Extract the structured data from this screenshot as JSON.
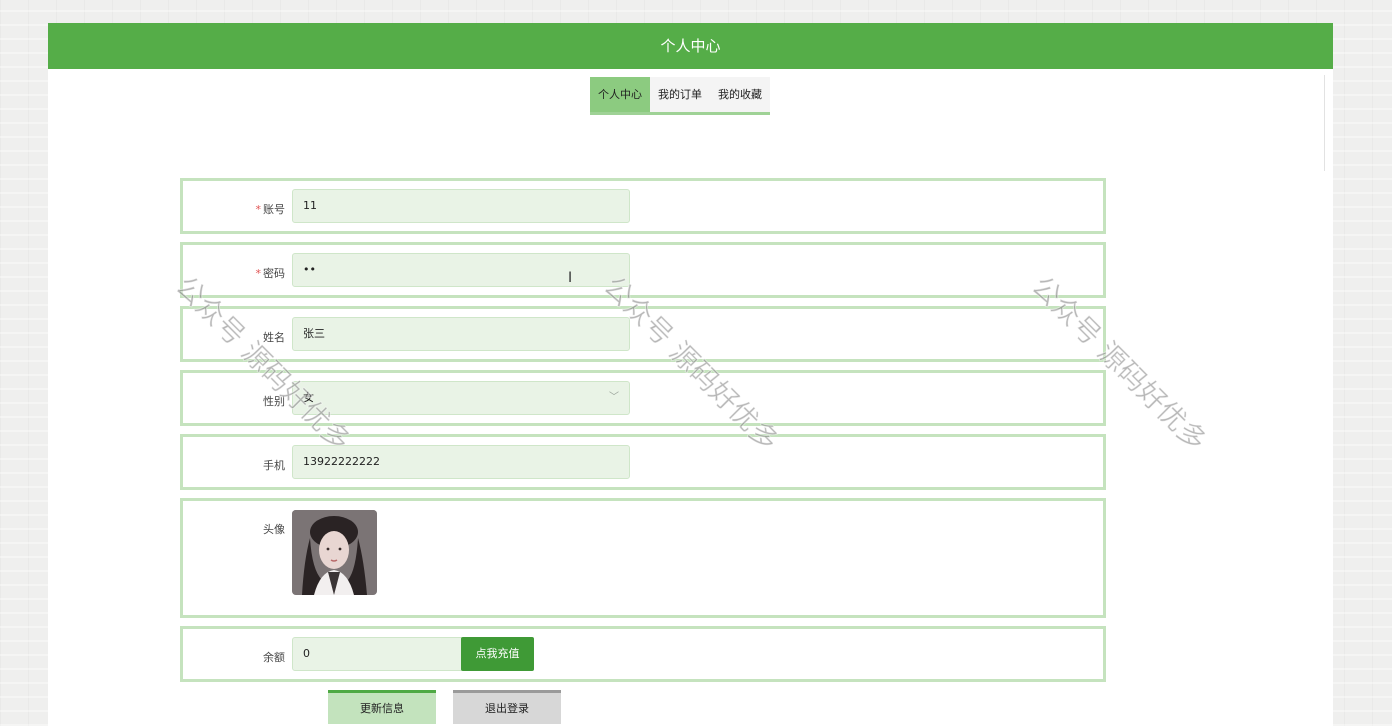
{
  "header": {
    "title": "个人中心"
  },
  "tabs": [
    {
      "label": "个人中心",
      "active": true
    },
    {
      "label": "我的订单",
      "active": false
    },
    {
      "label": "我的收藏",
      "active": false
    }
  ],
  "form": {
    "account": {
      "label": "账号",
      "value": "11",
      "required_mark": "*"
    },
    "password": {
      "label": "密码",
      "value": "••",
      "required_mark": "*"
    },
    "name": {
      "label": "姓名",
      "value": "张三"
    },
    "gender": {
      "label": "性别",
      "value": "女"
    },
    "phone": {
      "label": "手机",
      "value": "13922222222"
    },
    "avatar": {
      "label": "头像"
    },
    "balance": {
      "label": "余额",
      "value": "0",
      "recharge_label": "点我充值"
    }
  },
  "actions": {
    "update_label": "更新信息",
    "logout_label": "退出登录"
  },
  "watermark": {
    "text": "公众号 源码好优多"
  },
  "colors": {
    "brand": "#55ad48",
    "active_tab": "#8ccb80",
    "input_bg": "#e9f3e6",
    "row_border": "#c5e3be"
  }
}
